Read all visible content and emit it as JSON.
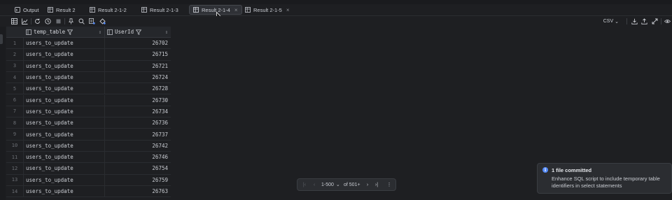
{
  "tabs": [
    {
      "label": "Output",
      "icon": "output-icon",
      "active": false
    },
    {
      "label": "Result 2",
      "icon": "table-icon",
      "active": false
    },
    {
      "label": "Result 2-1-2",
      "icon": "table-icon",
      "active": false
    },
    {
      "label": "Result 2-1-3",
      "icon": "table-icon",
      "active": false
    },
    {
      "label": "Result 2-1-4",
      "icon": "table-icon",
      "active": true,
      "close": "×"
    },
    {
      "label": "Result 2-1-5",
      "icon": "table-icon",
      "active": false,
      "close": "×"
    }
  ],
  "toolbar": {
    "left_icons": [
      "table-view-icon",
      "chart-view-icon",
      "refresh-icon",
      "history-icon",
      "stop-icon",
      "pin-icon",
      "search-icon",
      "compare-icon",
      "filter-edit-icon"
    ],
    "right_icons": [
      "download-icon",
      "upload-icon",
      "transpose-icon",
      "eye-icon"
    ],
    "export_format": "CSV",
    "export_chevron": "⌄"
  },
  "grid": {
    "columns": [
      {
        "label": "temp_table",
        "filter_icon": "filter-icon",
        "sort": "⇕"
      },
      {
        "label": "UserId",
        "filter_icon": "filter-icon",
        "sort": "⇕"
      }
    ],
    "rows": [
      {
        "n": "1",
        "temp_table": "users_to_update",
        "UserId": "26702"
      },
      {
        "n": "2",
        "temp_table": "users_to_update",
        "UserId": "26715"
      },
      {
        "n": "3",
        "temp_table": "users_to_update",
        "UserId": "26721"
      },
      {
        "n": "4",
        "temp_table": "users_to_update",
        "UserId": "26724"
      },
      {
        "n": "5",
        "temp_table": "users_to_update",
        "UserId": "26728"
      },
      {
        "n": "6",
        "temp_table": "users_to_update",
        "UserId": "26730"
      },
      {
        "n": "7",
        "temp_table": "users_to_update",
        "UserId": "26734"
      },
      {
        "n": "8",
        "temp_table": "users_to_update",
        "UserId": "26736"
      },
      {
        "n": "9",
        "temp_table": "users_to_update",
        "UserId": "26737"
      },
      {
        "n": "10",
        "temp_table": "users_to_update",
        "UserId": "26742"
      },
      {
        "n": "11",
        "temp_table": "users_to_update",
        "UserId": "26746"
      },
      {
        "n": "12",
        "temp_table": "users_to_update",
        "UserId": "26754"
      },
      {
        "n": "13",
        "temp_table": "users_to_update",
        "UserId": "26759"
      },
      {
        "n": "14",
        "temp_table": "users_to_update",
        "UserId": "26763"
      }
    ]
  },
  "pager": {
    "first": "|‹",
    "prev": "‹",
    "range": "1-500",
    "range_chevron": "⌄",
    "total": "of 501+",
    "next": "›",
    "last": "›|",
    "more": "⋮"
  },
  "toast": {
    "icon": "i",
    "title": "1 file committed",
    "message": "Enhance SQL script to include temporary table identifiers in select statements"
  },
  "colors": {
    "background": "#1e1f22",
    "accent": "#548af7",
    "text": "#c9ccd2"
  }
}
